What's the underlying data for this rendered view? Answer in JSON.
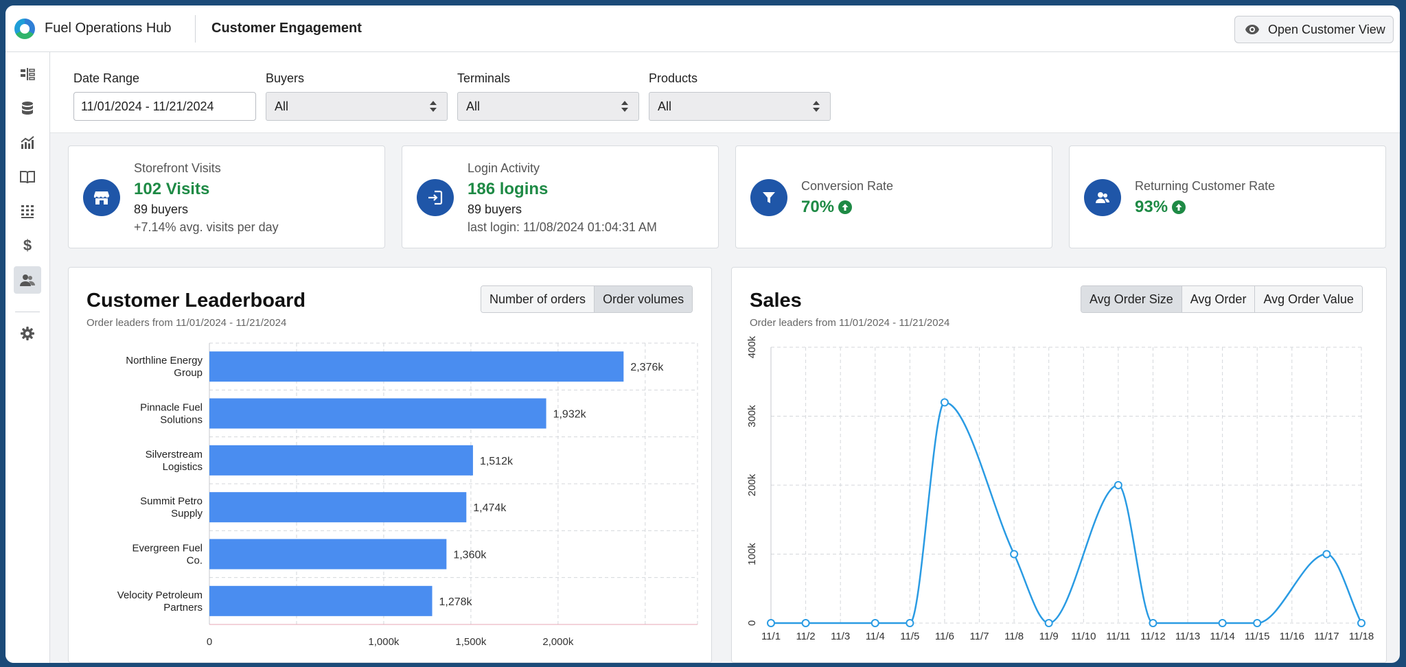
{
  "header": {
    "app_name": "Fuel Operations Hub",
    "page_title": "Customer Engagement",
    "open_view_label": "Open Customer View"
  },
  "sidebar": {
    "items": [
      {
        "icon": "layout-icon"
      },
      {
        "icon": "database-icon"
      },
      {
        "icon": "analytics-icon"
      },
      {
        "icon": "book-icon"
      },
      {
        "icon": "grid-icon"
      },
      {
        "icon": "dollar-icon"
      },
      {
        "icon": "customers-icon",
        "active": true
      },
      {
        "icon": "gear-icon"
      }
    ]
  },
  "filters": {
    "date_range": {
      "label": "Date Range",
      "value": "11/01/2024 - 11/21/2024"
    },
    "buyers": {
      "label": "Buyers",
      "value": "All"
    },
    "terminals": {
      "label": "Terminals",
      "value": "All"
    },
    "products": {
      "label": "Products",
      "value": "All"
    }
  },
  "kpis": [
    {
      "title": "Storefront Visits",
      "value": "102 Visits",
      "sub": "89 buyers",
      "sub2": "+7.14% avg. visits per day"
    },
    {
      "title": "Login Activity",
      "value": "186 logins",
      "sub": "89 buyers",
      "sub2": "last login: 11/08/2024 01:04:31 AM"
    },
    {
      "title": "Conversion Rate",
      "value": "70%"
    },
    {
      "title": "Returning Customer Rate",
      "value": "93%"
    }
  ],
  "leaderboard": {
    "title": "Customer Leaderboard",
    "subtitle": "Order leaders from 11/01/2024 - 11/21/2024",
    "toggle": [
      "Number of orders",
      "Order volumes"
    ],
    "selected_toggle": 1
  },
  "sales": {
    "title": "Sales",
    "subtitle": "Order leaders from 11/01/2024 - 11/21/2024",
    "toggle": [
      "Avg Order Size",
      "Avg Order",
      "Avg Order Value"
    ],
    "selected_toggle": 0
  },
  "colors": {
    "accent": "#1f56a8",
    "positive": "#1e8a45",
    "bar": "#4a8df0",
    "line": "#2a9be3"
  },
  "chart_data": [
    {
      "type": "bar",
      "orientation": "horizontal",
      "categories": [
        "Northline Energy Group",
        "Pinnacle Fuel Solutions",
        "Silverstream Logistics",
        "Summit Petro Supply",
        "Evergreen Fuel Co.",
        "Velocity Petroleum Partners"
      ],
      "category_lines": [
        [
          "Northline Energy",
          "Group"
        ],
        [
          "Pinnacle Fuel",
          "Solutions"
        ],
        [
          "Silverstream",
          "Logistics"
        ],
        [
          "Summit Petro",
          "Supply"
        ],
        [
          "Evergreen Fuel",
          "Co."
        ],
        [
          "Velocity Petroleum",
          "Partners"
        ]
      ],
      "values": [
        2376,
        1932,
        1512,
        1474,
        1360,
        1278
      ],
      "value_labels": [
        "2,376k",
        "1,932k",
        "1,512k",
        "1,474k",
        "1,360k",
        "1,278k"
      ],
      "xlim": [
        0,
        2800
      ],
      "x_ticks": [
        0,
        1000,
        1500,
        2000
      ],
      "x_tick_labels": [
        "0",
        "1,000k",
        "1,500k",
        "2,000k"
      ],
      "grid": true
    },
    {
      "type": "line",
      "x": [
        "11/1",
        "11/2",
        "11/3",
        "11/4",
        "11/5",
        "11/6",
        "11/7",
        "11/8",
        "11/9",
        "11/10",
        "11/11",
        "11/12",
        "11/13",
        "11/14",
        "11/15",
        "11/16",
        "11/17",
        "11/18"
      ],
      "x_points": [
        "11/1",
        "11/2",
        "11/4",
        "11/5",
        "11/6",
        "11/8",
        "11/9",
        "11/11",
        "11/12",
        "11/14",
        "11/15",
        "11/17",
        "11/18"
      ],
      "values": [
        0,
        0,
        0,
        0,
        320000,
        100000,
        0,
        200000,
        0,
        0,
        0,
        100000,
        0
      ],
      "ylim": [
        0,
        400000
      ],
      "y_ticks": [
        0,
        100000,
        200000,
        300000,
        400000
      ],
      "y_tick_labels": [
        "0",
        "100k",
        "200k",
        "300k",
        "400k"
      ],
      "grid": true
    }
  ]
}
